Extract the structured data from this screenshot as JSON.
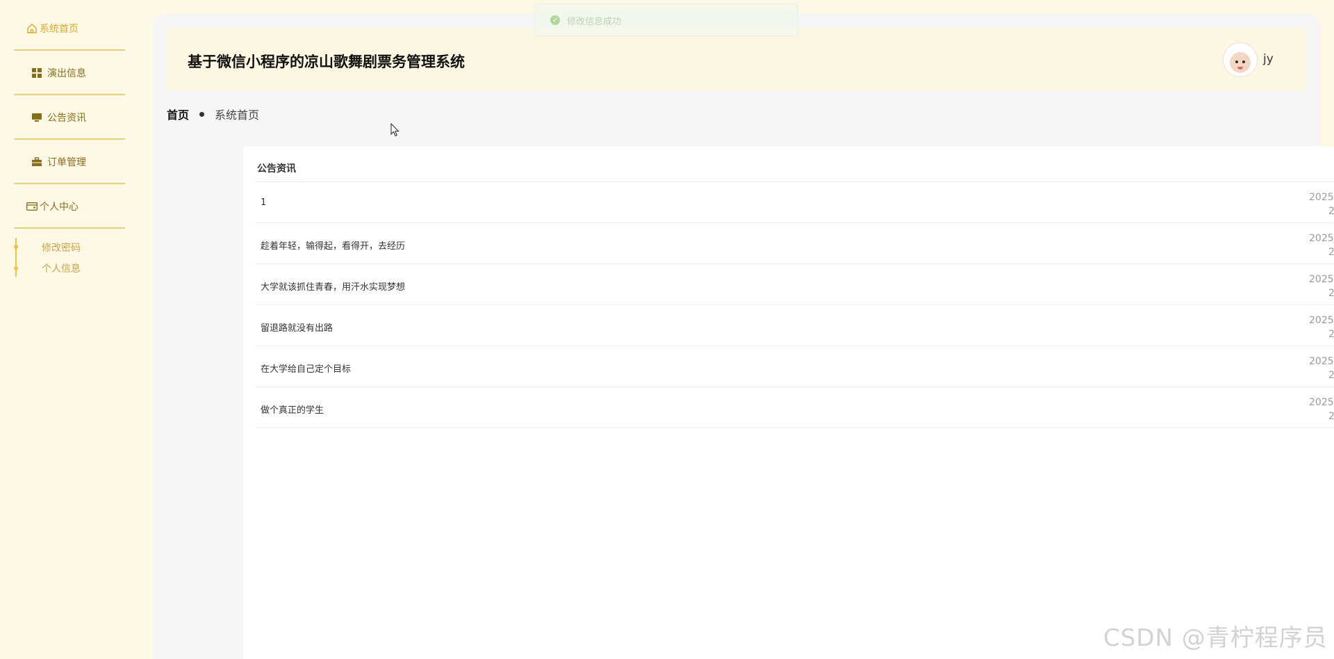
{
  "sidebar": {
    "items": [
      {
        "label": "系统首页",
        "icon": "home-icon"
      },
      {
        "label": "演出信息",
        "icon": "grid-icon"
      },
      {
        "label": "公告资讯",
        "icon": "monitor-icon"
      },
      {
        "label": "订单管理",
        "icon": "briefcase-icon"
      },
      {
        "label": "个人中心",
        "icon": "card-icon"
      }
    ],
    "subitems": [
      {
        "label": "修改密码"
      },
      {
        "label": "个人信息"
      }
    ]
  },
  "header": {
    "title": "基于微信小程序的凉山歌舞剧票务管理系统",
    "username": "jy"
  },
  "breadcrumb": {
    "home": "首页",
    "current": "系统首页"
  },
  "notice": {
    "title": "公告资讯",
    "rows": [
      {
        "title": "1",
        "date": "2025",
        "date2": "2"
      },
      {
        "title": "趁着年轻，输得起，看得开，去经历",
        "date": "2025",
        "date2": "2"
      },
      {
        "title": "大学就该抓住青春，用汗水实现梦想",
        "date": "2025",
        "date2": "2"
      },
      {
        "title": "留退路就没有出路",
        "date": "2025",
        "date2": "2"
      },
      {
        "title": "在大学给自己定个目标",
        "date": "2025",
        "date2": "2"
      },
      {
        "title": "做个真正的学生",
        "date": "2025",
        "date2": "2"
      }
    ]
  },
  "toast": {
    "message": "修改信息成功",
    "icon": "check-circle-icon"
  },
  "watermark": "CSDN @青柠程序员",
  "colors": {
    "accent": "#f3c33c",
    "sidebar_bg": "#fef8e6",
    "header_bg": "#fdf6e2"
  }
}
